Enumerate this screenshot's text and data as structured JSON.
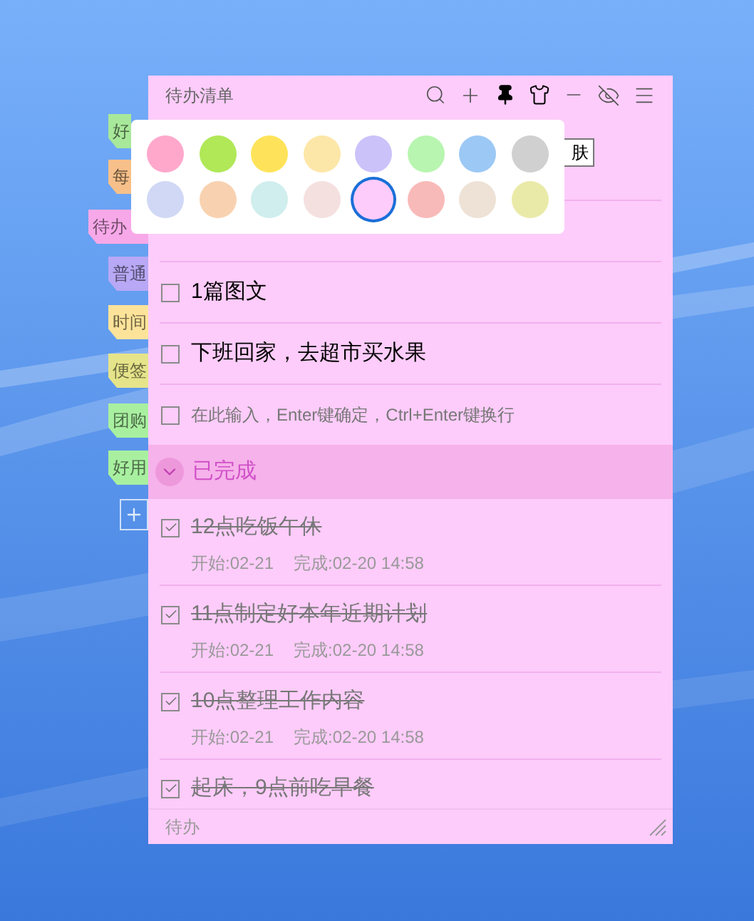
{
  "side_tabs": [
    {
      "label": "好",
      "color": "#a8e89a",
      "selected": false
    },
    {
      "label": "每",
      "color": "#f7c08a",
      "selected": false
    },
    {
      "label": "待办",
      "color": "#f7a8e8",
      "selected": true
    },
    {
      "label": "普通",
      "color": "#b8a8f5",
      "selected": false
    },
    {
      "label": "时间",
      "color": "#fde39a",
      "selected": false
    },
    {
      "label": "便签",
      "color": "#e6e48a",
      "selected": false
    },
    {
      "label": "团购",
      "color": "#a8f0a0",
      "selected": false
    },
    {
      "label": "好用",
      "color": "#a8f0a0",
      "selected": false
    }
  ],
  "window": {
    "title": "待办清单",
    "tooltip": "肤"
  },
  "palette": [
    {
      "color": "#ffa8cc",
      "selected": false
    },
    {
      "color": "#b0e858",
      "selected": false
    },
    {
      "color": "#fee35a",
      "selected": false
    },
    {
      "color": "#fde7a8",
      "selected": false
    },
    {
      "color": "#cbc2fa",
      "selected": false
    },
    {
      "color": "#b8f5b0",
      "selected": false
    },
    {
      "color": "#9cc8f5",
      "selected": false
    },
    {
      "color": "#d0d0d0",
      "selected": false
    },
    {
      "color": "#d0d8f5",
      "selected": false
    },
    {
      "color": "#f8d2b0",
      "selected": false
    },
    {
      "color": "#d0eeee",
      "selected": false
    },
    {
      "color": "#f5e0e0",
      "selected": false
    },
    {
      "color": "#fdccfa",
      "selected": true
    },
    {
      "color": "#f8bab8",
      "selected": false
    },
    {
      "color": "#eee2d6",
      "selected": false
    },
    {
      "color": "#eaeaa8",
      "selected": false
    }
  ],
  "todos": [
    {
      "text": "1篇图文",
      "checked": false
    },
    {
      "text": "下班回家，去超市买水果",
      "checked": false
    }
  ],
  "input": {
    "placeholder": "在此输入，Enter键确定，Ctrl+Enter键换行",
    "checked": false
  },
  "completed": {
    "label": "已完成",
    "expanded": true,
    "items": [
      {
        "text": "12点吃饭午休",
        "checked": true,
        "start": "开始:02-21",
        "done": "完成:02-20 14:58"
      },
      {
        "text": "11点制定好本年近期计划",
        "checked": true,
        "start": "开始:02-21",
        "done": "完成:02-20 14:58"
      },
      {
        "text": "10点整理工作内容",
        "checked": true,
        "start": "开始:02-21",
        "done": "完成:02-20 14:58"
      },
      {
        "text": "起床，9点前吃早餐",
        "checked": true
      }
    ]
  },
  "status_bar": {
    "text": "待办"
  }
}
